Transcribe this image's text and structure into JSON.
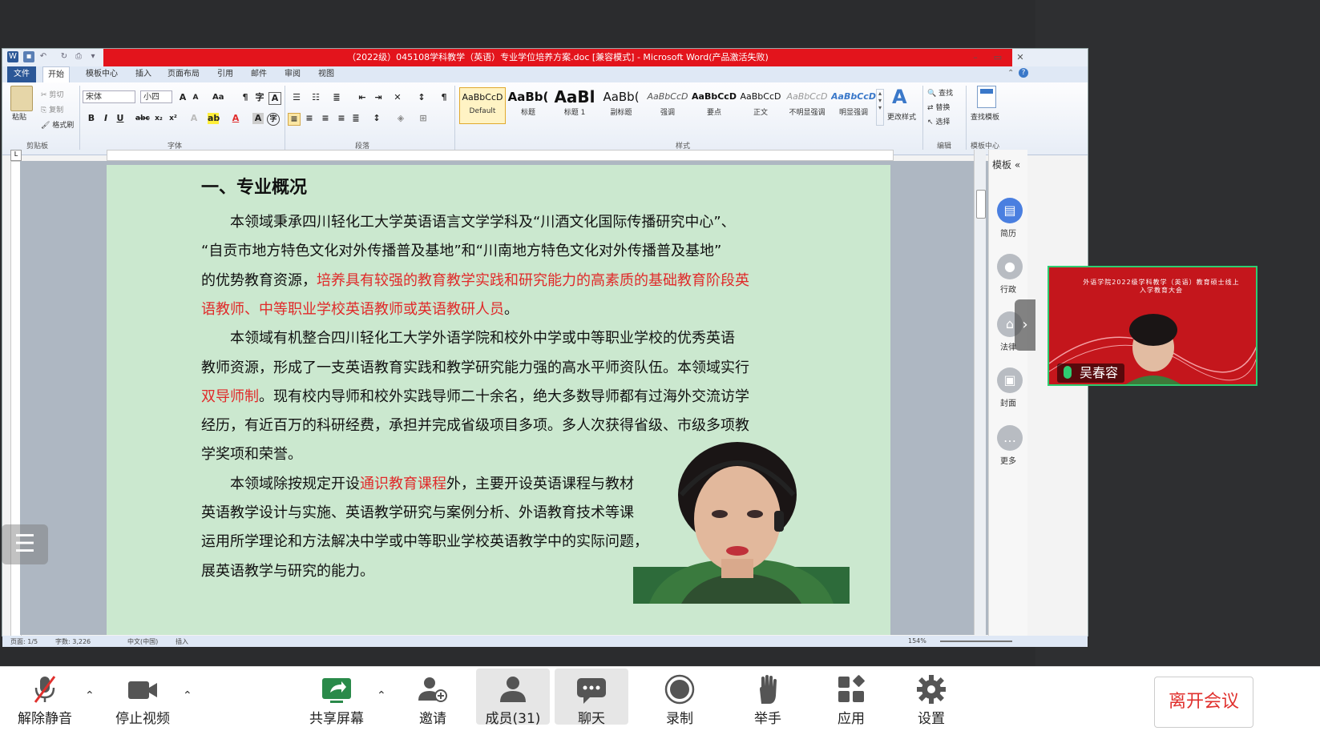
{
  "word": {
    "title": "（2022级）045108学科教学（英语）专业学位培养方案.doc [兼容模式] - Microsoft Word(产品激活失败)",
    "menus": [
      "文件",
      "开始",
      "模板中心",
      "插入",
      "页面布局",
      "引用",
      "邮件",
      "审阅",
      "视图"
    ],
    "clipboard": {
      "paste": "粘贴",
      "cut": "剪切",
      "copy": "复制",
      "format_painter": "格式刷",
      "label": "剪贴板"
    },
    "font": {
      "name": "宋体",
      "size": "小四",
      "label": "字体"
    },
    "paragraph_label": "段落",
    "styles": [
      {
        "sample": "AaBbCcD",
        "name": "Default"
      },
      {
        "sample": "AaBb(",
        "name": "标题"
      },
      {
        "sample": "AaBl",
        "name": "标题 1"
      },
      {
        "sample": "AaBb(",
        "name": "副标题"
      },
      {
        "sample": "AaBbCcD",
        "name": "强调"
      },
      {
        "sample": "AaBbCcD",
        "name": "要点"
      },
      {
        "sample": "AaBbCcD",
        "name": "正文"
      },
      {
        "sample": "AaBbCcD",
        "name": "不明显强调"
      },
      {
        "sample": "AaBbCcD",
        "name": "明显强调"
      }
    ],
    "styles_label": "样式",
    "change_styles": "更改样式",
    "edit": {
      "find": "查找",
      "replace": "替换",
      "select": "选择",
      "label": "编辑"
    },
    "template_search": "查找模板",
    "template_center_label": "模板中心",
    "side_panel": {
      "title": "模板",
      "items": [
        "简历",
        "行政",
        "法律",
        "封面",
        "更多"
      ]
    },
    "status": {
      "page": "页面: 1/5",
      "words": "字数: 3,226",
      "language": "中文(中国)",
      "insert": "插入",
      "zoom": "154%"
    },
    "document": {
      "heading": "一、专业概况",
      "lines": [
        [
          {
            "t": "　　本领域秉承四川轻化工大学英语语言文学学科及“川酒文化国际传播研究中心”、",
            "r": false
          }
        ],
        [
          {
            "t": "“自贡市地方特色文化对外传播普及基地”和“川南地方特色文化对外传播普及基地”",
            "r": false
          }
        ],
        [
          {
            "t": "的优势教育资源，",
            "r": false
          },
          {
            "t": "培养具有较强的教育教学实践和研究能力的高素质的基础教育阶段英",
            "r": true
          }
        ],
        [
          {
            "t": "语教师、中等职业学校英语教师或英语教研人员",
            "r": true
          },
          {
            "t": "。",
            "r": false
          }
        ],
        [
          {
            "t": "　　本领域有机整合四川轻化工大学外语学院和校外中学或中等职业学校的优秀英语",
            "r": false
          }
        ],
        [
          {
            "t": "教师资源，形成了一支英语教育实践和教学研究能力强的高水平师资队伍。本领域实行",
            "r": false
          }
        ],
        [
          {
            "t": "双导师制",
            "r": true
          },
          {
            "t": "。现有校内导师和校外实践导师二十余名，绝大多数导师都有过海外交流访学",
            "r": false
          }
        ],
        [
          {
            "t": "经历，有近百万的科研经费，承担并完成省级项目多项。多人次获得省级、市级多项教",
            "r": false
          }
        ],
        [
          {
            "t": "学奖项和荣誉。",
            "r": false
          }
        ],
        [
          {
            "t": "　　本领域除按规定开设",
            "r": false
          },
          {
            "t": "通识教育课程",
            "r": true
          },
          {
            "t": "外，主要开设英语课程与教材",
            "r": false
          }
        ],
        [
          {
            "t": "英语教学设计与实施、英语教学研究与案例分析、外语教育技术等课",
            "r": false
          }
        ],
        [
          {
            "t": "运用所学理论和方法解决中学或中等职业学校英语教学中的实际问题，",
            "r": false
          }
        ],
        [
          {
            "t": "展英语教学与研究的能力。",
            "r": false
          }
        ]
      ]
    }
  },
  "meeting": {
    "thumbnail": {
      "title": "外语学院2022级学科教学（英语）教育硕士线上入学教育大会",
      "name": "吴春容"
    },
    "toolbar": [
      {
        "id": "unmute",
        "label": "解除静音",
        "icon": "mic-muted-icon",
        "caret": true
      },
      {
        "id": "stop-video",
        "label": "停止视频",
        "icon": "video-camera-icon",
        "caret": true
      },
      {
        "id": "share",
        "label": "共享屏幕",
        "icon": "share-screen-icon",
        "caret": true
      },
      {
        "id": "invite",
        "label": "邀请",
        "icon": "invite-user-icon",
        "caret": false
      },
      {
        "id": "members",
        "label": "成员(31)",
        "icon": "members-icon",
        "caret": false
      },
      {
        "id": "chat",
        "label": "聊天",
        "icon": "chat-icon",
        "caret": false
      },
      {
        "id": "record",
        "label": "录制",
        "icon": "record-icon",
        "caret": false
      },
      {
        "id": "raise-hand",
        "label": "举手",
        "icon": "raise-hand-icon",
        "caret": false
      },
      {
        "id": "apps",
        "label": "应用",
        "icon": "apps-icon",
        "caret": false
      },
      {
        "id": "settings",
        "label": "设置",
        "icon": "gear-icon",
        "caret": false
      }
    ],
    "leave": "离开会议"
  },
  "colors": {
    "accent_red": "#e3141c",
    "doc_bg": "#cbe8cf",
    "text_red": "#e02a2a",
    "share_green": "#2a8a4a",
    "thumb_border": "#2ecc71"
  }
}
